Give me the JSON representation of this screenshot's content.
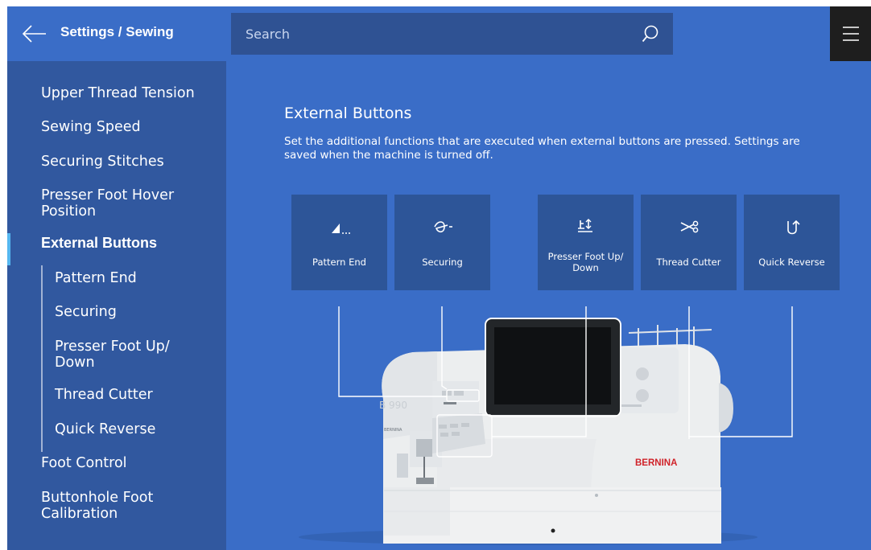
{
  "header": {
    "breadcrumb": "Settings / Sewing",
    "search_placeholder": "Search"
  },
  "sidebar": {
    "items": [
      {
        "label": "Upper Thread Tension"
      },
      {
        "label": "Sewing Speed"
      },
      {
        "label": "Securing Stitches"
      },
      {
        "label": "Presser Foot Hover Position"
      },
      {
        "label": "External Buttons",
        "active": true
      },
      {
        "label": "Pattern End",
        "sub": true
      },
      {
        "label": "Securing",
        "sub": true
      },
      {
        "label": "Presser Foot Up/ Down",
        "sub": true
      },
      {
        "label": "Thread Cutter",
        "sub": true
      },
      {
        "label": "Quick Reverse",
        "sub": true
      },
      {
        "label": "Foot Control"
      },
      {
        "label": "Buttonhole Foot Calibration"
      }
    ]
  },
  "main": {
    "title": "External Buttons",
    "description": "Set the additional functions that are executed when external buttons are pressed. Settings are saved when the machine is turned off.",
    "buttons": [
      {
        "label": "Pattern End",
        "icon": "pattern-end-icon"
      },
      {
        "label": "Securing",
        "icon": "securing-icon"
      },
      {
        "label": "Presser Foot Up/ Down",
        "icon": "presser-foot-icon"
      },
      {
        "label": "Thread Cutter",
        "icon": "thread-cutter-icon"
      },
      {
        "label": "Quick Reverse",
        "icon": "quick-reverse-icon"
      }
    ],
    "machine_model": "B 990",
    "brand": "BERNINA",
    "brand_small": "BERNINA"
  },
  "colors": {
    "topbar": "#3a6dc7",
    "sidebar": "#31589f",
    "search": "#2f5293",
    "button": "#2d5598",
    "active_marker": "#55b7f0",
    "brand_red": "#d0232a"
  }
}
